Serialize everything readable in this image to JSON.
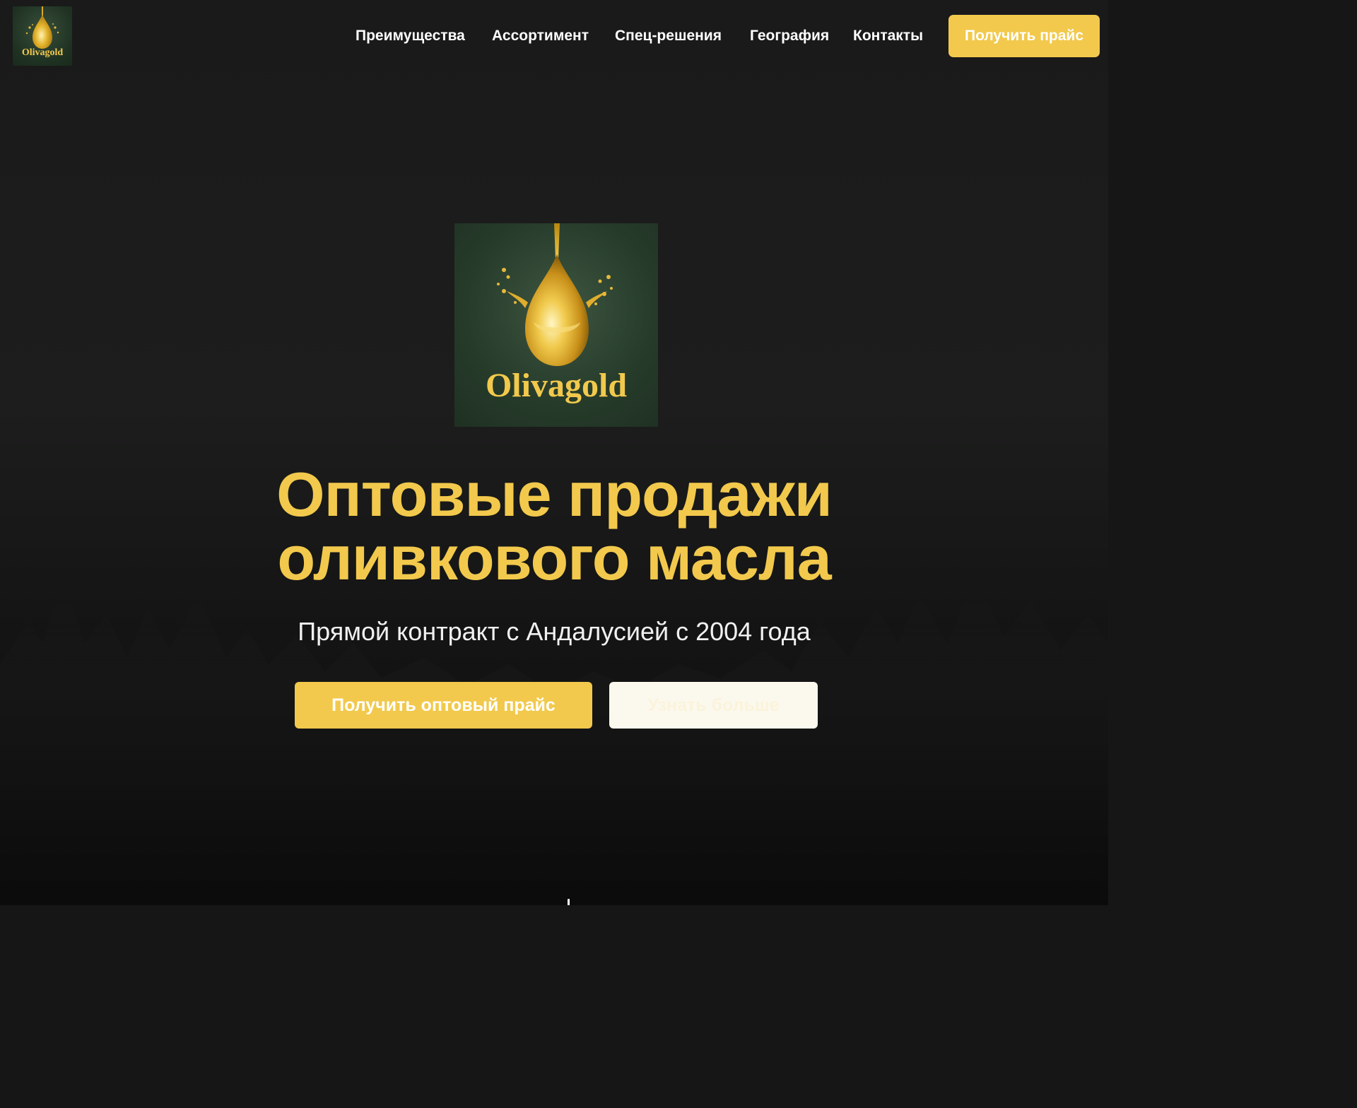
{
  "header": {
    "logo_text": "Olivagold",
    "nav": [
      {
        "label": "Преимущества"
      },
      {
        "label": "Ассортимент"
      },
      {
        "label": "Спец-решения"
      },
      {
        "label": "География"
      },
      {
        "label": "Контакты"
      }
    ],
    "cta_label": "Получить прайс"
  },
  "hero": {
    "logo_text": "Olivagold",
    "title_line1": "Оптовые продажи",
    "title_line2": "оливкового масла",
    "subtitle": "Прямой контракт с Андалусией с 2004 года",
    "primary_button": "Получить оптовый прайс",
    "secondary_button": "Узнать больше"
  },
  "colors": {
    "accent": "#f2c94c",
    "background": "#1a1a1a",
    "logo_green": "#263b2a",
    "secondary_button_bg": "#fbf8ee"
  },
  "icons": {
    "logo": "olive-oil-drop-icon",
    "scroll": "scroll-down-icon"
  }
}
